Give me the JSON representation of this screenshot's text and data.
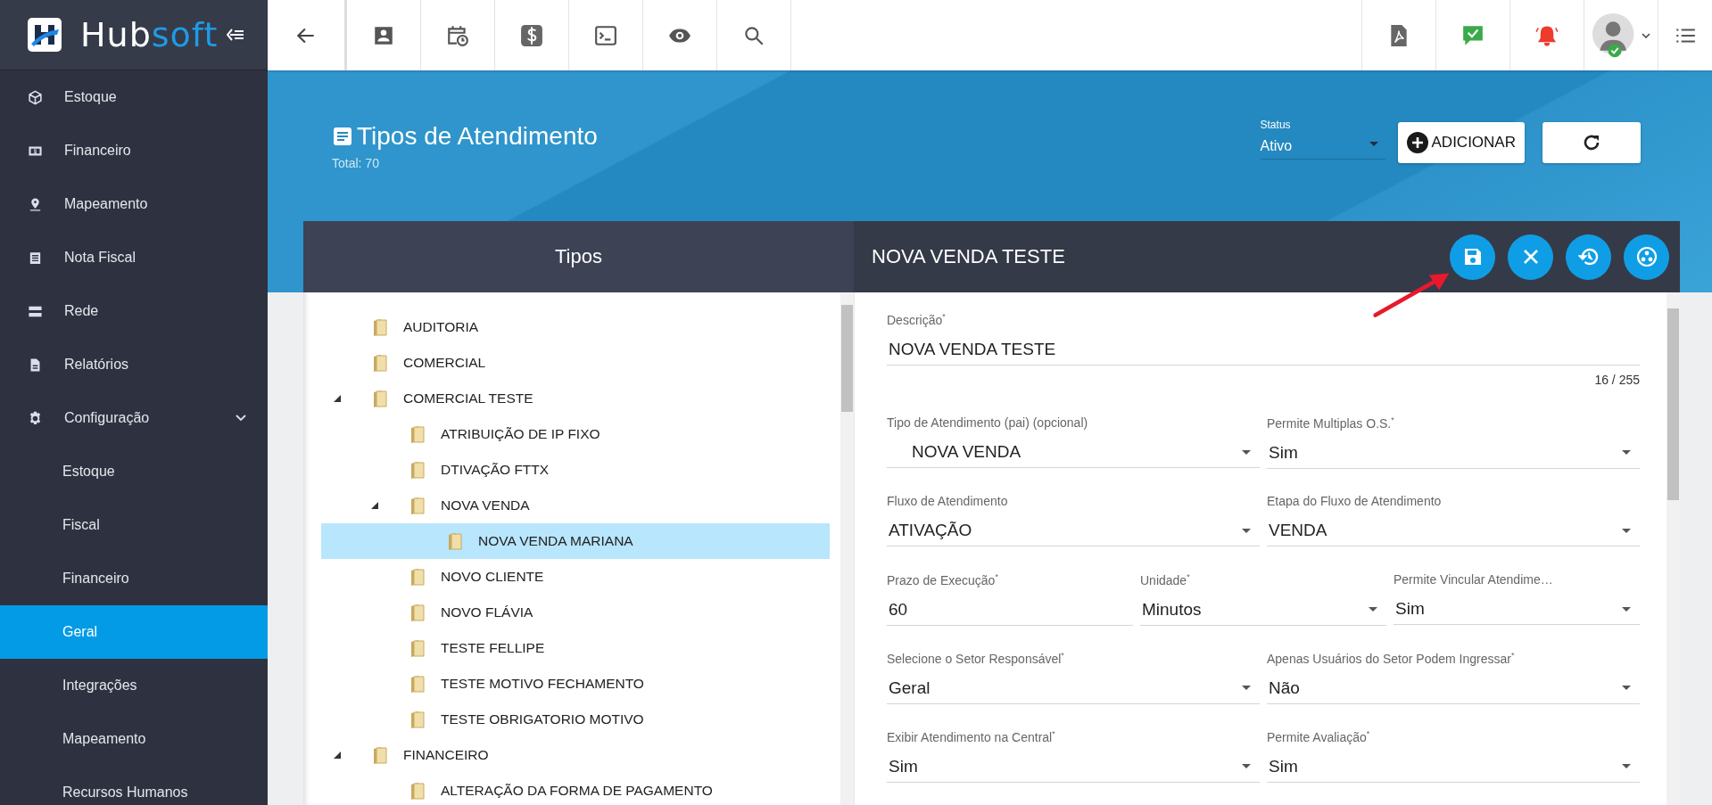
{
  "sidebar": {
    "logo_text": "Hub",
    "logo_accent": "soft",
    "items": [
      {
        "label": "Estoque",
        "selected": false
      },
      {
        "label": "Financeiro",
        "selected": false
      },
      {
        "label": "Mapeamento",
        "selected": false
      },
      {
        "label": "Nota Fiscal",
        "selected": false
      },
      {
        "label": "Rede",
        "selected": false
      },
      {
        "label": "Relatórios",
        "selected": false
      },
      {
        "label": "Configuração",
        "selected": false,
        "expanded": true,
        "children": [
          {
            "label": "Estoque",
            "selected": false
          },
          {
            "label": "Fiscal",
            "selected": false
          },
          {
            "label": "Financeiro",
            "selected": false
          },
          {
            "label": "Geral",
            "selected": true
          },
          {
            "label": "Integrações",
            "selected": false
          },
          {
            "label": "Mapeamento",
            "selected": false
          },
          {
            "label": "Recursos Humanos",
            "selected": false
          }
        ]
      }
    ]
  },
  "header": {
    "title": "Tipos de Atendimento",
    "total": "Total: 70",
    "status": {
      "label": "Status",
      "value": "Ativo"
    },
    "add_button": "ADICIONAR"
  },
  "panel": {
    "list_title": "Tipos",
    "form_title": "NOVA VENDA TESTE",
    "tree": [
      {
        "label": "AUDITORIA",
        "selected": false
      },
      {
        "label": "COMERCIAL",
        "selected": false
      },
      {
        "label": "COMERCIAL TESTE",
        "selected": false,
        "expanded": true,
        "children": [
          {
            "label": "ATRIBUIÇÃO DE IP FIXO",
            "selected": false
          },
          {
            "label": "DTIVAÇÃO FTTX",
            "selected": false
          },
          {
            "label": "NOVA VENDA",
            "selected": false,
            "expanded": true,
            "children": [
              {
                "label": "NOVA VENDA MARIANA",
                "selected": true
              }
            ]
          },
          {
            "label": "NOVO CLIENTE",
            "selected": false
          },
          {
            "label": "NOVO FLÁVIA",
            "selected": false
          },
          {
            "label": "TESTE FELLIPE",
            "selected": false
          },
          {
            "label": "TESTE MOTIVO FECHAMENTO",
            "selected": false
          },
          {
            "label": "TESTE OBRIGATORIO MOTIVO",
            "selected": false
          }
        ]
      },
      {
        "label": "FINANCEIRO",
        "selected": false,
        "expanded": true,
        "children": [
          {
            "label": "ALTERAÇÃO DA FORMA DE PAGAMENTO",
            "selected": false
          }
        ]
      }
    ],
    "form_rows": [
      [
        {
          "label": "Descrição$^{*}$",
          "value": "NOVA VENDA TESTE",
          "kind": "text",
          "counter": "16 / 255"
        }
      ],
      [
        {
          "label": "Tipo de Atendimento (pai) (opcional)",
          "value": "NOVA VENDA",
          "kind": "tree-select"
        },
        {
          "label": "Permite Multiplas O.S.$^{*}$",
          "value": "Sim",
          "kind": "select"
        }
      ],
      [
        {
          "label": "Fluxo de Atendimento",
          "value": "ATIVAÇÃO",
          "kind": "select"
        },
        {
          "label": "Etapa do Fluxo de Atendimento",
          "value": "VENDA",
          "kind": "select"
        }
      ],
      [
        {
          "label": "Prazo de Execução$^{*}$",
          "value": "60",
          "kind": "text"
        },
        {
          "label": "Unidade$^{*}$",
          "value": "Minutos",
          "kind": "select"
        },
        {
          "label": "Permite Vincular Atendime…",
          "value": "Sim",
          "kind": "select"
        }
      ],
      [
        {
          "label": "Selecione o Setor Responsável$^{*}$",
          "value": "Geral",
          "kind": "select"
        },
        {
          "label": "Apenas Usuários do Setor Podem Ingressar$^{*}$",
          "value": "Não",
          "kind": "select"
        }
      ],
      [
        {
          "label": "Exibir Atendimento na Central$^{*}$",
          "value": "Sim",
          "kind": "select"
        },
        {
          "label": "Permite Avaliação$^{*}$",
          "value": "Sim",
          "kind": "select"
        }
      ]
    ]
  }
}
